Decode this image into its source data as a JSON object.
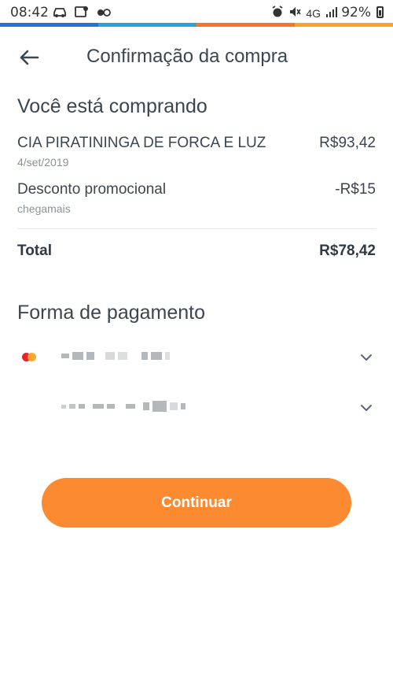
{
  "status_bar": {
    "time": "08:42",
    "network": "4G",
    "battery": "92%",
    "left_icons": [
      "car-mode-icon",
      "photo-location-icon",
      "voicemail-icon"
    ],
    "right_icons": [
      "alarm-icon",
      "mute-icon",
      "network-4g-icon",
      "signal-icon",
      "battery-icon"
    ]
  },
  "stripe_colors": [
    "#2a6fd6",
    "#2aa3d6",
    "#f2772a",
    "#f7a428"
  ],
  "header": {
    "title": "Confirmação da compra",
    "back_icon": "arrow-left-icon"
  },
  "purchase": {
    "section_title": "Você está comprando",
    "items": [
      {
        "name": "CIA PIRATININGA DE FORCA E LUZ",
        "sub": "4/set/2019",
        "value": "R$93,42"
      },
      {
        "name": "Desconto promocional",
        "sub": "chegamais",
        "value": "-R$15"
      }
    ],
    "total_label": "Total",
    "total_value": "R$78,42"
  },
  "payment": {
    "section_title": "Forma de pagamento",
    "methods": [
      {
        "icon": "mastercard-icon",
        "masked": true
      },
      {
        "icon": null,
        "masked": true
      }
    ],
    "chevron_icon": "chevron-down-icon"
  },
  "actions": {
    "continue_label": "Continuar"
  },
  "colors": {
    "accent": "#fb8a30",
    "text": "#3b4650",
    "subtext": "#8a9299"
  }
}
